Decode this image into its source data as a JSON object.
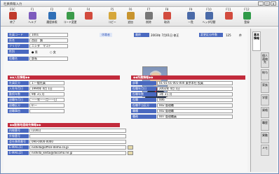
{
  "window": {
    "title": "社員情報入力"
  },
  "toolbar": {
    "items": [
      {
        "key": "ESC",
        "label": "終了",
        "icon": "exit-icon",
        "color": "#c0392b"
      },
      {
        "key": "F1",
        "label": "ヘルプ",
        "icon": "help-icon",
        "color": "#7d5bbd"
      },
      {
        "key": "F2",
        "label": "履歴参照",
        "icon": "history-icon",
        "color": "#2f6fb7"
      },
      {
        "key": "F3",
        "label": "コード変更",
        "icon": "code-change-icon",
        "color": "#3b9b4a"
      },
      {
        "key": "F4",
        "label": "",
        "icon": "cancel-icon",
        "color": "#d24b3e"
      },
      {
        "key": "F5",
        "label": "コピー",
        "icon": "copy-icon",
        "color": "#d6a73a"
      },
      {
        "key": "F6",
        "label": "追加",
        "icon": "add-icon",
        "color": "#c8942e"
      },
      {
        "key": "F7",
        "label": "削除",
        "icon": "delete-icon",
        "color": "#777777"
      },
      {
        "key": "F8",
        "label": "取消",
        "icon": "undo-icon",
        "color": "#d24b3e"
      },
      {
        "key": "F9",
        "label": "一覧",
        "icon": "list-icon",
        "color": "#4a6aa8"
      },
      {
        "key": "F10",
        "label": "ヘッダ切替",
        "icon": "switch-icon",
        "color": "#4a6aa8"
      },
      {
        "key": "F11",
        "label": "",
        "icon": "disabled-icon",
        "color": "#d24b3e"
      },
      {
        "key": "F12",
        "label": "登録",
        "icon": "save-icon",
        "color": "#2f9a48"
      }
    ]
  },
  "basic": {
    "code_label": "社員コード",
    "code_value": "1001",
    "kanji_label": "氏名",
    "kanji_value": "西田　誠",
    "kana_label": "フリガナ",
    "kana_value": "ニシダ　マコト",
    "sex_label": "性別",
    "sex_male": "男",
    "sex_female": "女",
    "post_label": "役職名",
    "post_value": "部長",
    "badge": "休職者",
    "changed_label": "最終",
    "changed_value": "2003年 7月01日 修正",
    "rev_label": "変更区分件数",
    "rev_value": "125",
    "rev_unit": "件"
  },
  "sec_company": {
    "title": "◆◆入社情報◆◆",
    "rows": [
      {
        "label": "社員区分",
        "value": "1:一般社員"
      },
      {
        "label": "入社年月日",
        "value": "1994年 4月 1日"
      },
      {
        "label": "勤続年数",
        "value": "9年 3ヶ月"
      },
      {
        "label": "退職年月日",
        "value": "——年——月——日"
      },
      {
        "label": "退職区分",
        "value": "0:—"
      },
      {
        "label": "退職事由",
        "value": ""
      }
    ]
  },
  "sec_dept": {
    "title": "◆◆所属情報◆◆",
    "rows": [
      {
        "label": "部署",
        "value": "01-01-01-001-000 東京本社 役員"
      },
      {
        "label": "役職年月日",
        "value": "2002年 4月 1日"
      },
      {
        "label": "役職年数",
        "value": "1年 3ヶ月"
      },
      {
        "label": "役職",
        "value": "006"
      },
      {
        "label": "役職手当区分",
        "value": "002 管理職"
      },
      {
        "label": "職種",
        "value": "002 管理職"
      },
      {
        "label": "職務",
        "value": "007 管理職員"
      }
    ]
  },
  "sec_contact": {
    "title": "◆◆勤務地連絡先情報◆◆",
    "rows": [
      {
        "label": "内線番号",
        "value": "(1001)"
      },
      {
        "label": "外線番号",
        "value": ""
      },
      {
        "label": "会社携帯番号",
        "value": "090-0000-0000"
      },
      {
        "label": "E-MAIL(1)",
        "value": "nishida@office-demo.co.jp"
      },
      {
        "label": "E-MAIL(2)",
        "value": "nishida_keitai@docomo.ne.jp"
      }
    ]
  },
  "tabs": [
    {
      "label": "基本情報",
      "selected": true
    },
    {
      "label": "個人連絡先"
    },
    {
      "label": "給与"
    },
    {
      "label": "家族"
    },
    {
      "label": "学歴"
    },
    {
      "label": "資格"
    },
    {
      "label": "職歴"
    },
    {
      "label": "異動"
    },
    {
      "label": "メモ"
    }
  ]
}
